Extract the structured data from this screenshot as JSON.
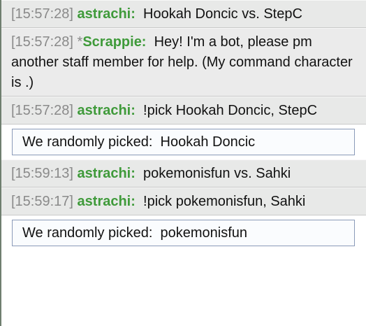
{
  "messages": [
    {
      "type": "chat",
      "time": "[15:57:28]",
      "prefix": "",
      "user": "astrachi:",
      "text": "Hookah Doncic vs. StepC"
    },
    {
      "type": "chat",
      "time": "[15:57:28]",
      "prefix": "*",
      "user": "Scrappie:",
      "text": "Hey! I'm a bot, please pm another staff member for help. (My command character is .)"
    },
    {
      "type": "chat",
      "time": "[15:57:28]",
      "prefix": "",
      "user": "astrachi:",
      "text": "!pick Hookah Doncic, StepC"
    },
    {
      "type": "infobox",
      "label": "We randomly picked:",
      "value": "Hookah Doncic"
    },
    {
      "type": "chat",
      "time": "[15:59:13]",
      "prefix": "",
      "user": "astrachi:",
      "text": "pokemonisfun vs. Sahki"
    },
    {
      "type": "chat",
      "time": "[15:59:17]",
      "prefix": "",
      "user": "astrachi:",
      "text": "!pick pokemonisfun, Sahki"
    },
    {
      "type": "infobox",
      "label": "We randomly picked:",
      "value": "pokemonisfun"
    }
  ],
  "colors": {
    "username": "#3f9a3a",
    "timestamp": "#8a8a8a",
    "infobox_border": "#8a9ab8"
  }
}
